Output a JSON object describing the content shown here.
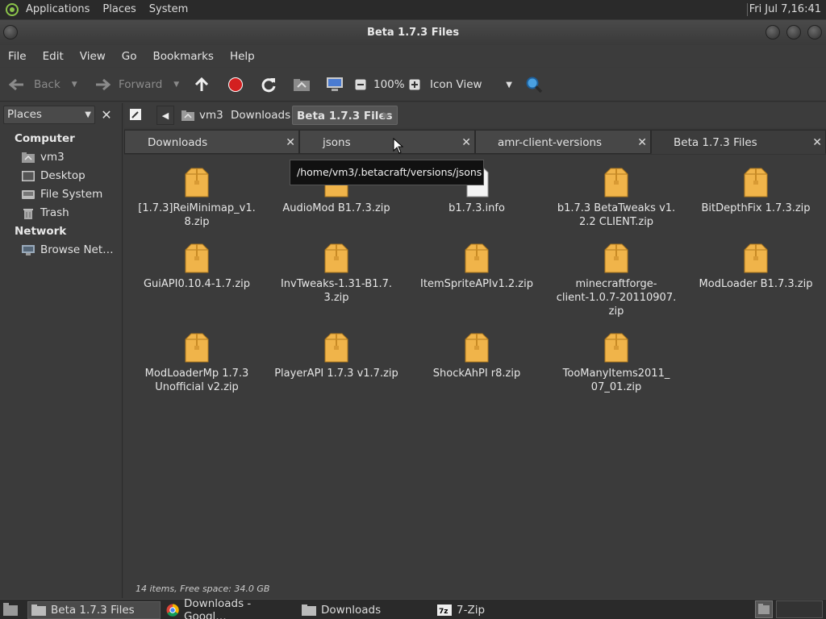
{
  "panel": {
    "applications": "Applications",
    "places": "Places",
    "system": "System",
    "clock": "Fri Jul 7,16:41"
  },
  "window": {
    "title": "Beta 1.7.3 Files"
  },
  "menu": {
    "file": "File",
    "edit": "Edit",
    "view": "View",
    "go": "Go",
    "bookmarks": "Bookmarks",
    "help": "Help"
  },
  "toolbar": {
    "back": "Back",
    "forward": "Forward",
    "zoom": "100%",
    "view_mode": "Icon View"
  },
  "sidebar": {
    "selector": "Places",
    "sections": [
      {
        "title": "Computer",
        "items": [
          "vm3",
          "Desktop",
          "File System",
          "Trash"
        ]
      },
      {
        "title": "Network",
        "items": [
          "Browse Net…"
        ]
      }
    ]
  },
  "breadcrumbs": [
    "vm3",
    "Downloads",
    "Beta 1.7.3 Files"
  ],
  "tabs": [
    {
      "label": "Downloads"
    },
    {
      "label": "jsons"
    },
    {
      "label": "amr-client-versions"
    },
    {
      "label": "Beta 1.7.3 Files",
      "active": true
    }
  ],
  "tooltip": "/home/vm3/.betacraft/versions/jsons",
  "files": [
    {
      "line1": "[1.7.3]ReiMinimap_v1.",
      "line2": "8.zip",
      "line3": ""
    },
    {
      "line1": "AudioMod B1.7.3.zip",
      "line2": "",
      "line3": ""
    },
    {
      "line1": "b1.7.3.info",
      "line2": "",
      "line3": ""
    },
    {
      "line1": "b1.7.3 BetaTweaks v1.",
      "line2": "2.2 CLIENT.zip",
      "line3": ""
    },
    {
      "line1": "BitDepthFix 1.7.3.zip",
      "line2": "",
      "line3": ""
    },
    {
      "line1": "GuiAPI0.10.4-1.7.zip",
      "line2": "",
      "line3": ""
    },
    {
      "line1": "InvTweaks-1.31-B1.7.",
      "line2": "3.zip",
      "line3": ""
    },
    {
      "line1": "ItemSpriteAPIv1.2.zip",
      "line2": "",
      "line3": ""
    },
    {
      "line1": "minecraftforge-",
      "line2": "client-1.0.7-20110907.",
      "line3": "zip"
    },
    {
      "line1": "ModLoader B1.7.3.zip",
      "line2": "",
      "line3": ""
    },
    {
      "line1": "ModLoaderMp 1.7.3",
      "line2": "Unofficial v2.zip",
      "line3": ""
    },
    {
      "line1": "PlayerAPI 1.7.3 v1.7.zip",
      "line2": "",
      "line3": ""
    },
    {
      "line1": "ShockAhPI r8.zip",
      "line2": "",
      "line3": ""
    },
    {
      "line1": "TooManyItems2011_",
      "line2": "07_01.zip",
      "line3": ""
    }
  ],
  "status": "14 items, Free space: 34.0 GB",
  "taskbar": {
    "items": [
      "Beta 1.7.3 Files",
      "Downloads - Googl…",
      "Downloads",
      "7-Zip"
    ]
  },
  "colors": {
    "panel": "#2a2a2a",
    "window_bg": "#3b3b3b",
    "folder": "#f0b44a",
    "accent_red": "#d32020",
    "search": "#4aa0e0"
  }
}
